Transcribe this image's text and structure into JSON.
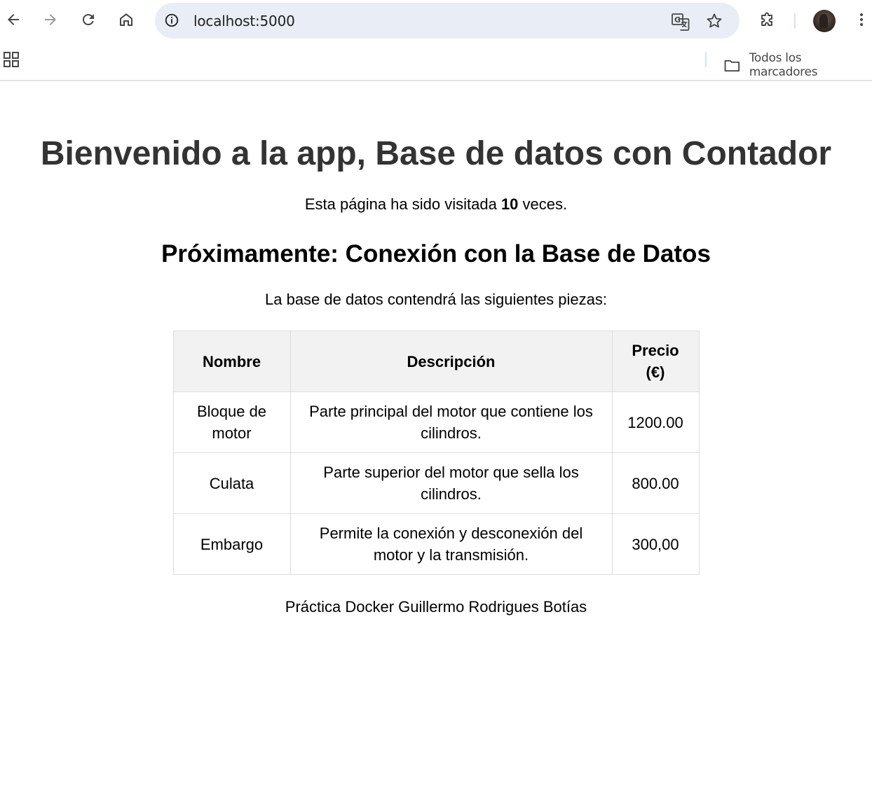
{
  "browser": {
    "url": "localhost:5000",
    "bookmarks_folder": "Todos los marcadores",
    "icons": {
      "back": "back-arrow-icon",
      "forward": "forward-arrow-icon",
      "reload": "reload-icon",
      "home": "home-icon",
      "info": "info-icon",
      "translate": "translate-icon",
      "bookmark": "star-icon",
      "extensions": "puzzle-icon",
      "menu": "kebab-menu-icon",
      "apps": "apps-grid-icon",
      "folder": "folder-icon"
    }
  },
  "page": {
    "title": "Bienvenido a la app, Base de datos con Contador",
    "visits_prefix": "Esta página ha sido visitada ",
    "visits_count": "10",
    "visits_suffix": " veces.",
    "subtitle": "Próximamente: Conexión con la Base de Datos",
    "intro": "La base de datos contendrá las siguientes piezas:",
    "footer": "Práctica Docker Guillermo Rodrigues Botías"
  },
  "table": {
    "headers": [
      "Nombre",
      "Descripción",
      "Precio (€)"
    ],
    "rows": [
      [
        "Bloque de motor",
        "Parte principal del motor que contiene los cilindros.",
        "1200.00"
      ],
      [
        "Culata",
        "Parte superior del motor que sella los cilindros.",
        "800.00"
      ],
      [
        "Embargo",
        "Permite la conexión y desconexión del motor y la transmisión.",
        "300,00"
      ]
    ]
  },
  "colors": {
    "omnibox_bg": "#e9eef6",
    "heading": "#333333",
    "table_header_bg": "#f2f2f2",
    "table_border": "#dddddd"
  }
}
